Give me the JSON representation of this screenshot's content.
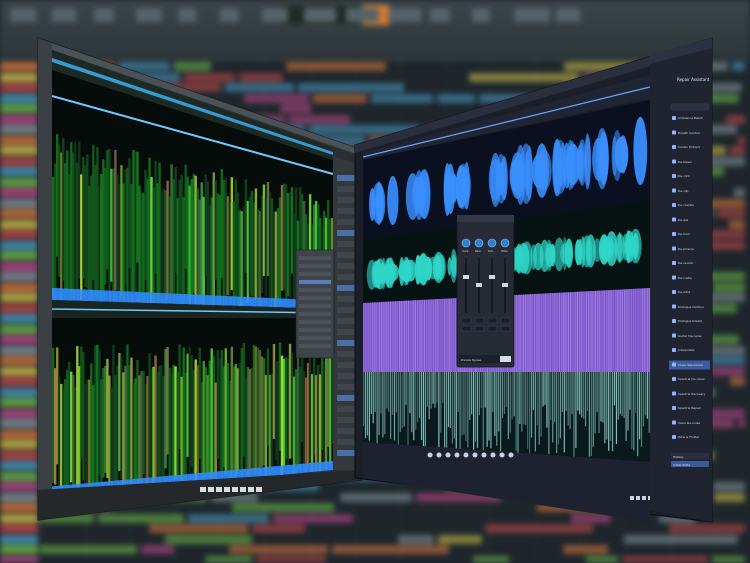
{
  "background": {
    "app": "daw-playlist",
    "accent_colors": [
      "#e07a3f",
      "#d6c64a",
      "#c94a4a",
      "#4aa0c9",
      "#6fc24a",
      "#c24a8e",
      "#8b9aa3"
    ]
  },
  "left_window": {
    "title": "",
    "view": "stereo-spectrogram",
    "status_text": "",
    "colors": {
      "waveform": "#3fb6ff",
      "spectrum": "#2fe05a",
      "bg": "#060c0a"
    }
  },
  "right_window": {
    "title": "",
    "module_panel_title": "Repair Assistant",
    "modules": [
      "Ambience Match",
      "Breath Control",
      "Center Extract",
      "De-bleed",
      "De-click",
      "De-clip",
      "De-crackle",
      "De-ess",
      "De-hum",
      "De-plosive",
      "De-reverb",
      "De-rustle",
      "De-wind",
      "Dialogue Contour",
      "Dialogue Isolate",
      "Guitar De-noise",
      "Interpolate",
      "Music Rebalance",
      "Spectral De-noise",
      "Spectral Recovery",
      "Spectral Repair",
      "Voice De-noise",
      "Wow & Flutter"
    ],
    "selected_module": "Music Rebalance",
    "history_title": "History",
    "history_item": "Initial State",
    "mixer": {
      "channels": [
        "Voice",
        "Bass",
        "Perc.",
        "Other"
      ],
      "bottom_buttons": [
        "Preview",
        "Bypass"
      ],
      "extra_label": "Apply"
    },
    "track_colors": [
      "#3a8fff",
      "#2fd6c8",
      "#9a62e8",
      "#7fd8d0"
    ]
  }
}
